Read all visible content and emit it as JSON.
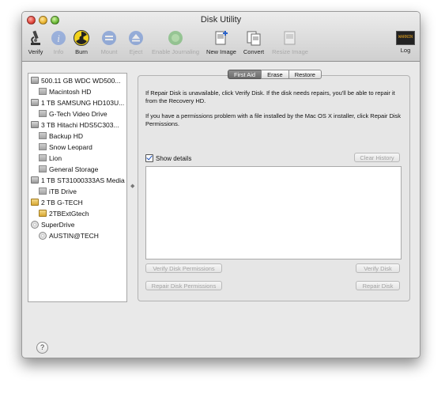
{
  "window": {
    "title": "Disk Utility"
  },
  "toolbar": {
    "verify": "Verify",
    "info": "Info",
    "burn": "Burn",
    "mount": "Mount",
    "eject": "Eject",
    "enable_journaling": "Enable Journaling",
    "new_image": "New Image",
    "convert": "Convert",
    "resize_image": "Resize Image",
    "log": "Log",
    "log_icon_text": "WARNIN"
  },
  "sidebar": {
    "items": [
      {
        "label": "500.11 GB WDC WD500...",
        "icon": "hard-drive-icon"
      },
      {
        "label": "Macintosh HD",
        "icon": "volume-icon"
      },
      {
        "label": "1 TB SAMSUNG HD103U...",
        "icon": "hard-drive-icon"
      },
      {
        "label": "G-Tech Video Drive",
        "icon": "volume-icon"
      },
      {
        "label": "3 TB Hitachi HDS5C303...",
        "icon": "hard-drive-icon"
      },
      {
        "label": "Backup HD",
        "icon": "volume-icon"
      },
      {
        "label": "Snow Leopard",
        "icon": "volume-icon"
      },
      {
        "label": "Lion",
        "icon": "volume-icon"
      },
      {
        "label": "General Storage",
        "icon": "volume-icon"
      },
      {
        "label": "1 TB ST31000333AS Media",
        "icon": "hard-drive-icon"
      },
      {
        "label": "iTB Drive",
        "icon": "volume-icon"
      },
      {
        "label": "2 TB G-TECH",
        "icon": "external-drive-icon"
      },
      {
        "label": "2TBExtGtech",
        "icon": "external-volume-icon"
      },
      {
        "label": "SuperDrive",
        "icon": "optical-drive-icon"
      },
      {
        "label": "AUSTIN@TECH",
        "icon": "disc-icon"
      }
    ]
  },
  "tabs": [
    {
      "label": "First Aid",
      "active": true
    },
    {
      "label": "Erase",
      "active": false
    },
    {
      "label": "Restore",
      "active": false
    }
  ],
  "first_aid": {
    "paragraph1": "If Repair Disk is unavailable, click Verify Disk. If the disk needs repairs, you'll be able to repair it from the Recovery HD.",
    "paragraph2": "If you have a permissions problem with a file installed by the Mac OS X installer, click Repair Disk Permissions.",
    "show_details": "Show details",
    "show_details_checked": true,
    "clear_history": "Clear History",
    "verify_permissions": "Verify Disk Permissions",
    "repair_permissions": "Repair Disk Permissions",
    "verify_disk": "Verify Disk",
    "repair_disk": "Repair Disk"
  },
  "help": {
    "label": "?"
  },
  "colors": {
    "active_tab": "#7a7a7a",
    "accent_check": "#1c4fb8"
  }
}
